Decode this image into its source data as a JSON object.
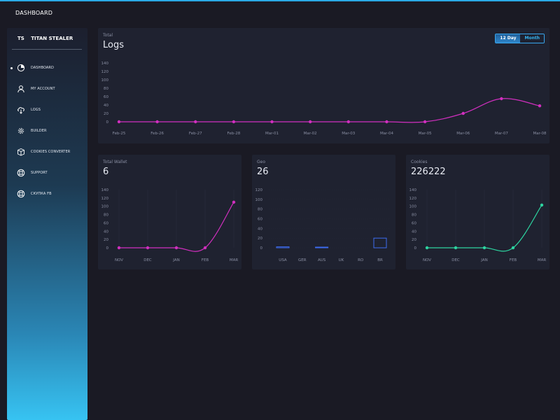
{
  "header": {
    "title": "DASHBOARD"
  },
  "sidebar": {
    "brand_abbr": "TS",
    "brand_name": "TITAN STEALER",
    "items": [
      {
        "label": "DASHBOARD",
        "icon": "dashboard-icon",
        "active": true
      },
      {
        "label": "MY ACCOUNT",
        "icon": "user-icon",
        "active": false
      },
      {
        "label": "LOGS",
        "icon": "cloud-download-icon",
        "active": false
      },
      {
        "label": "BUILDER",
        "icon": "gear-icon",
        "active": false
      },
      {
        "label": "COOKIES CONVERTER",
        "icon": "box-icon",
        "active": false
      },
      {
        "label": "SUPPORT",
        "icon": "lifebuoy-icon",
        "active": false
      },
      {
        "label": "СКУПКА FB",
        "icon": "lifebuoy-icon",
        "active": false
      }
    ]
  },
  "logs_card": {
    "small": "Total",
    "big": "Logs",
    "toggle": {
      "day_label": "12 Day",
      "month_label": "Month",
      "selected": "12 Day"
    }
  },
  "wallet_card": {
    "small": "Total Wallet",
    "big": "6"
  },
  "geo_card": {
    "small": "Geo",
    "big": "26"
  },
  "cookies_card": {
    "small": "Cookies",
    "big": "226222"
  },
  "colors": {
    "magenta": "#d12fbf",
    "teal": "#2dd4a0",
    "blue": "#3d6cf0",
    "accent": "#37b4f0"
  },
  "chart_data": [
    {
      "id": "logs",
      "type": "line",
      "categories": [
        "Feb-25",
        "Feb-26",
        "Feb-27",
        "Feb-28",
        "Mar-01",
        "Mar-02",
        "Mar-03",
        "Mar-04",
        "Mar-05",
        "Mar-06",
        "Mar-07",
        "Mar-08"
      ],
      "values": [
        0,
        0,
        0,
        0,
        0,
        0,
        0,
        0,
        0,
        20,
        55,
        38
      ],
      "ylim": [
        0,
        140
      ],
      "yticks": [
        0,
        20,
        40,
        60,
        80,
        100,
        120,
        140
      ],
      "color": "#d12fbf"
    },
    {
      "id": "wallet",
      "type": "line",
      "categories": [
        "NOV",
        "DEC",
        "JAN",
        "FEB",
        "MAR"
      ],
      "values": [
        0,
        0,
        0,
        0,
        110
      ],
      "ylim": [
        0,
        140
      ],
      "yticks": [
        0,
        20,
        40,
        60,
        80,
        100,
        120,
        140
      ],
      "color": "#d12fbf"
    },
    {
      "id": "geo",
      "type": "bar",
      "categories": [
        "USA",
        "GER",
        "AUS",
        "UK",
        "RO",
        "BR"
      ],
      "values": [
        2,
        0,
        0.5,
        0,
        0,
        20
      ],
      "ylim": [
        0,
        120
      ],
      "yticks": [
        0,
        20,
        40,
        60,
        80,
        100,
        120
      ],
      "color": "#3d6cf0"
    },
    {
      "id": "cookies",
      "type": "line",
      "categories": [
        "NOV",
        "DEC",
        "JAN",
        "FEB",
        "MAR"
      ],
      "values": [
        0,
        0,
        0,
        0,
        103
      ],
      "ylim": [
        0,
        140
      ],
      "yticks": [
        0,
        20,
        40,
        60,
        80,
        100,
        120,
        140
      ],
      "color": "#2dd4a0"
    }
  ]
}
